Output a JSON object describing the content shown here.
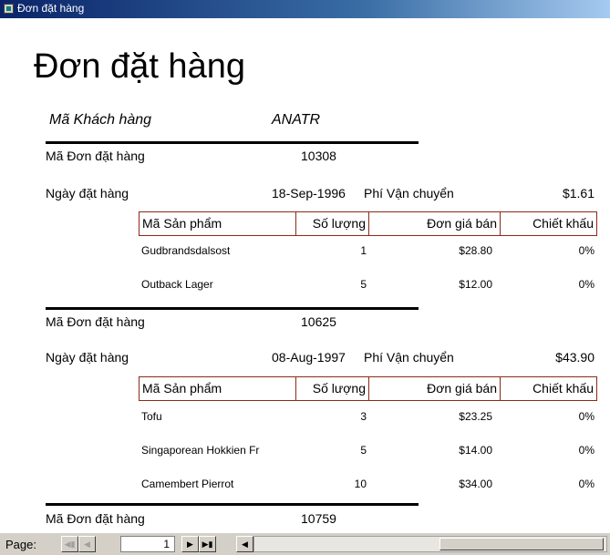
{
  "window": {
    "title": "Đơn đặt hàng"
  },
  "report": {
    "title": "Đơn đặt hàng",
    "customer_label": "Mã Khách hàng",
    "customer_id": "ANATR",
    "order_id_label": "Mã Đơn đặt hàng",
    "order_date_label": "Ngày đặt hàng",
    "freight_label": "Phí Vận chuyển",
    "columns": [
      "Mã Sản phẩm",
      "Số lượng",
      "Đơn giá bán",
      "Chiết khấu"
    ],
    "orders": [
      {
        "id": "10308",
        "date": "18-Sep-1996",
        "freight": "$1.61",
        "items": [
          {
            "product": "Gudbrandsdalsost",
            "qty": "1",
            "price": "$28.80",
            "discount": "0%"
          },
          {
            "product": "Outback Lager",
            "qty": "5",
            "price": "$12.00",
            "discount": "0%"
          }
        ]
      },
      {
        "id": "10625",
        "date": "08-Aug-1997",
        "freight": "$43.90",
        "items": [
          {
            "product": "Tofu",
            "qty": "3",
            "price": "$23.25",
            "discount": "0%"
          },
          {
            "product": "Singaporean Hokkien Fr",
            "qty": "5",
            "price": "$14.00",
            "discount": "0%"
          },
          {
            "product": "Camembert Pierrot",
            "qty": "10",
            "price": "$34.00",
            "discount": "0%"
          }
        ]
      },
      {
        "id": "10759"
      }
    ]
  },
  "navigation": {
    "page_label": "Page:",
    "page_number": "1"
  }
}
